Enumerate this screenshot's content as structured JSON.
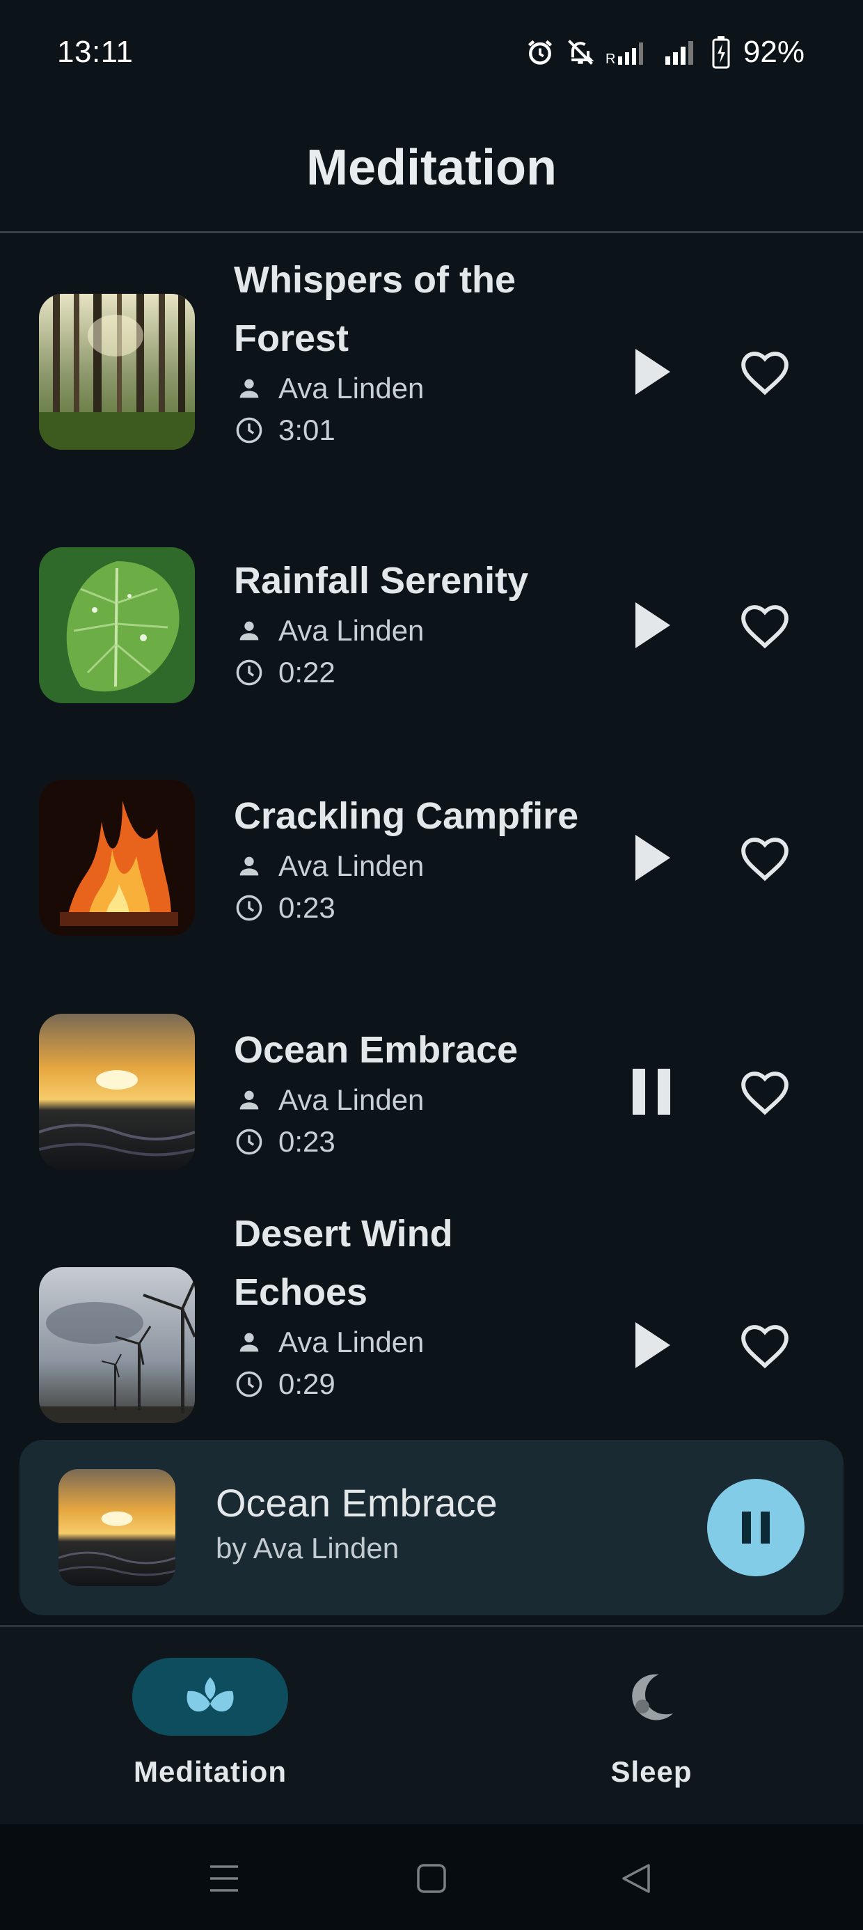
{
  "status_bar": {
    "time": "13:11",
    "battery": "92%",
    "icons": [
      "alarm-icon",
      "bell-off-icon",
      "signal-roaming-icon",
      "signal-icon",
      "battery-charging-icon"
    ]
  },
  "header": {
    "title": "Meditation"
  },
  "tracks": [
    {
      "title": "Whispers of the Forest",
      "artist": "Ava Linden",
      "duration": "3:01",
      "state": "play",
      "image": "forest"
    },
    {
      "title": "Rainfall Serenity",
      "artist": "Ava Linden",
      "duration": "0:22",
      "state": "play",
      "image": "leaf"
    },
    {
      "title": "Crackling Campfire",
      "artist": "Ava Linden",
      "duration": "0:23",
      "state": "play",
      "image": "campfire"
    },
    {
      "title": "Ocean Embrace",
      "artist": "Ava Linden",
      "duration": "0:23",
      "state": "pause",
      "image": "ocean"
    },
    {
      "title": "Desert Wind Echoes",
      "artist": "Ava Linden",
      "duration": "0:29",
      "state": "play",
      "image": "windmill"
    }
  ],
  "now_playing": {
    "title": "Ocean Embrace",
    "artist": "by Ava Linden",
    "image": "ocean"
  },
  "bottom_nav": {
    "items": [
      {
        "label": "Meditation",
        "icon": "lotus-icon",
        "active": true
      },
      {
        "label": "Sleep",
        "icon": "moon-icon",
        "active": false
      }
    ]
  },
  "system_nav": {
    "icons": [
      "recents-icon",
      "home-icon",
      "back-icon"
    ]
  },
  "colors": {
    "background": "#0c1419",
    "card": "#1a2a32",
    "accent": "#82cce8",
    "active_pill": "#0d4d5e"
  }
}
